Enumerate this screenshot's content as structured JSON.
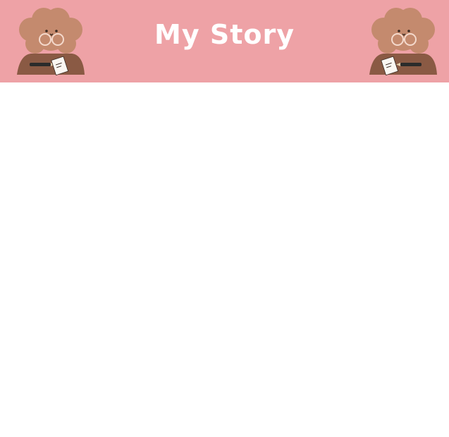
{
  "header": {
    "title": "My Story",
    "background_color": "#eea2a6",
    "title_color": "#ffffff"
  },
  "decorations": {
    "left_icon": "poodle-writing-icon",
    "right_icon": "poodle-writing-icon",
    "fur_color": "#c48a6e",
    "desk_color": "#8a5a44"
  },
  "content": {
    "background_color": "#ffffff"
  }
}
